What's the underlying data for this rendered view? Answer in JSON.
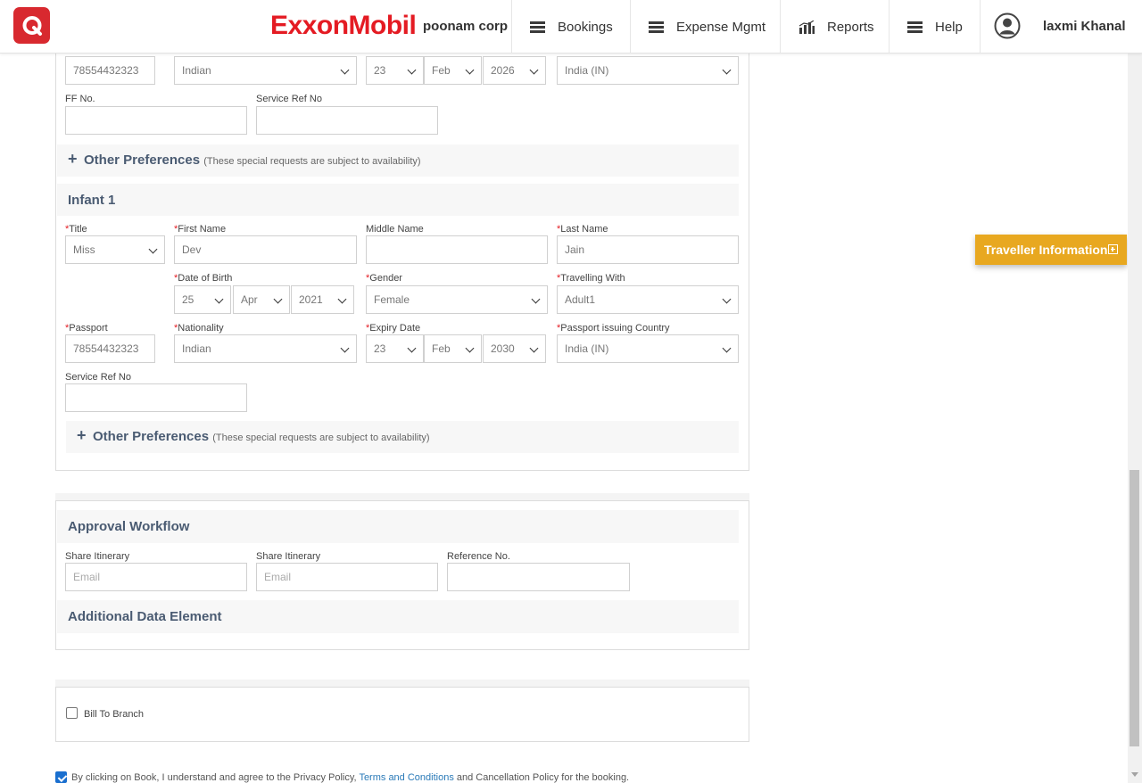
{
  "header": {
    "app_logo_icon": "q-logo-icon",
    "brand": "ExxonMobil",
    "corp": "poonam corp",
    "nav": [
      {
        "label": "Bookings",
        "icon": "menu-icon"
      },
      {
        "label": "Expense Mgmt",
        "icon": "menu-icon"
      },
      {
        "label": "Reports",
        "icon": "bar-chart-icon"
      },
      {
        "label": "Help",
        "icon": "menu-icon"
      }
    ],
    "user": "laxmi Khanal"
  },
  "prev_traveller": {
    "passport_value": "78554432323",
    "nationality": "Indian",
    "expiry_day": "23",
    "expiry_month": "Feb",
    "expiry_year": "2026",
    "issuing_country": "India (IN)",
    "ff_label": "FF No.",
    "ff_value": "",
    "service_ref_label": "Service Ref No",
    "service_ref_value": ""
  },
  "other_pref": {
    "title": "Other Preferences",
    "subtitle": "(These special requests are subject to availability)"
  },
  "infant": {
    "heading": "Infant 1",
    "title_label": "Title",
    "title_value": "Miss",
    "first_name_label": "First Name",
    "first_name_value": "Dev",
    "middle_name_label": "Middle Name",
    "middle_name_value": "",
    "last_name_label": "Last Name",
    "last_name_value": "Jain",
    "dob_label": "Date of Birth",
    "dob_day": "25",
    "dob_month": "Apr",
    "dob_year": "2021",
    "gender_label": "Gender",
    "gender_value": "Female",
    "travelling_with_label": "Travelling With",
    "travelling_with_value": "Adult1",
    "passport_label": "Passport",
    "passport_value": "78554432323",
    "nationality_label": "Nationality",
    "nationality_value": "Indian",
    "expiry_label": "Expiry Date",
    "expiry_day": "23",
    "expiry_month": "Feb",
    "expiry_year": "2030",
    "issuing_country_label": "Passport issuing Country",
    "issuing_country_value": "India (IN)",
    "service_ref_label": "Service Ref No",
    "service_ref_value": ""
  },
  "approval": {
    "heading": "Approval Workflow",
    "share1_label": "Share Itinerary",
    "share1_placeholder": "Email",
    "share2_label": "Share Itinerary",
    "share2_placeholder": "Email",
    "reference_label": "Reference No.",
    "reference_value": "",
    "additional_heading": "Additional Data Element"
  },
  "billing": {
    "bill_to_branch_label": "Bill To Branch",
    "bill_to_branch_checked": false
  },
  "agreement": {
    "checked": true,
    "text_before": "By clicking on Book, I understand and agree to the Privacy Policy, ",
    "link_text": "Terms and Conditions",
    "text_after": " and Cancellation Policy for the booking."
  },
  "side": {
    "traveller_info_label": "Traveller Information",
    "traveller_info_icon": "plus-square-icon"
  },
  "colors": {
    "brand_red": "#e41b23",
    "accent_orange": "#e8a820",
    "section_title": "#4a5b72",
    "link_blue": "#2a7ab8"
  }
}
